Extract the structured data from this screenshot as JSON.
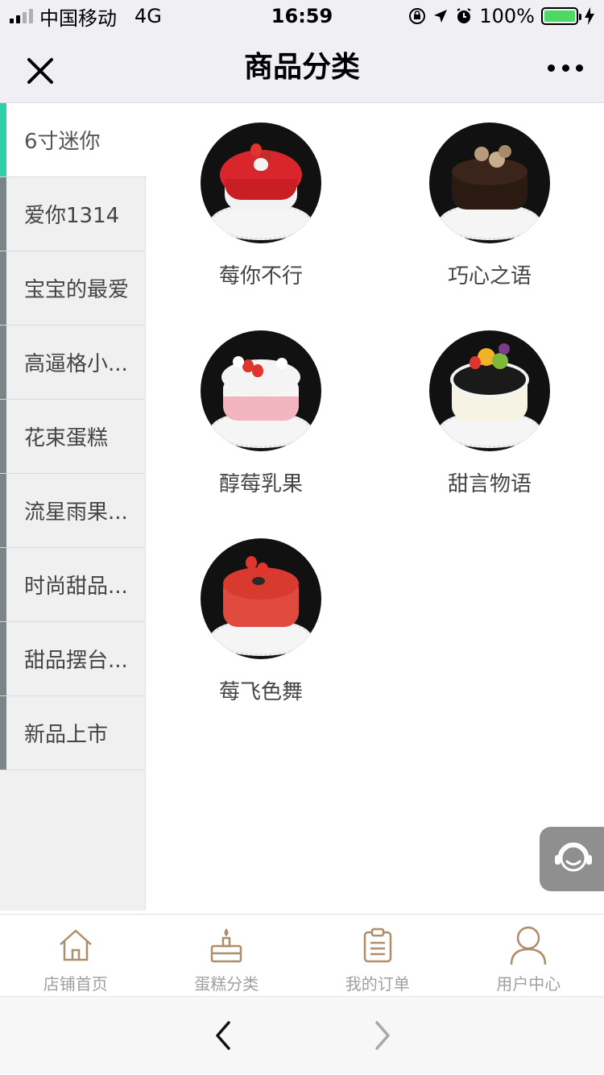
{
  "status_bar": {
    "carrier": "中国移动",
    "network": "4G",
    "time": "16:59",
    "battery": "100%"
  },
  "nav": {
    "title": "商品分类"
  },
  "categories": [
    {
      "label": "6寸迷你",
      "active": true
    },
    {
      "label": "爱你1314"
    },
    {
      "label": "宝宝的最爱"
    },
    {
      "label": "高逼格小..."
    },
    {
      "label": "花束蛋糕"
    },
    {
      "label": "流星雨果..."
    },
    {
      "label": "时尚甜品..."
    },
    {
      "label": "甜品摆台..."
    },
    {
      "label": "新品上市"
    }
  ],
  "products": [
    {
      "name": "莓你不行"
    },
    {
      "name": "巧心之语"
    },
    {
      "name": "醇莓乳果"
    },
    {
      "name": "甜言物语"
    },
    {
      "name": "莓飞色舞"
    }
  ],
  "tabs": [
    {
      "label": "店铺首页",
      "icon": "home-icon"
    },
    {
      "label": "蛋糕分类",
      "icon": "cake-icon"
    },
    {
      "label": "我的订单",
      "icon": "clipboard-icon"
    },
    {
      "label": "用户中心",
      "icon": "user-icon"
    }
  ],
  "colors": {
    "active_indicator": "#2fd0a8",
    "tab_icon": "#b08d6a",
    "battery": "#4cd964"
  }
}
